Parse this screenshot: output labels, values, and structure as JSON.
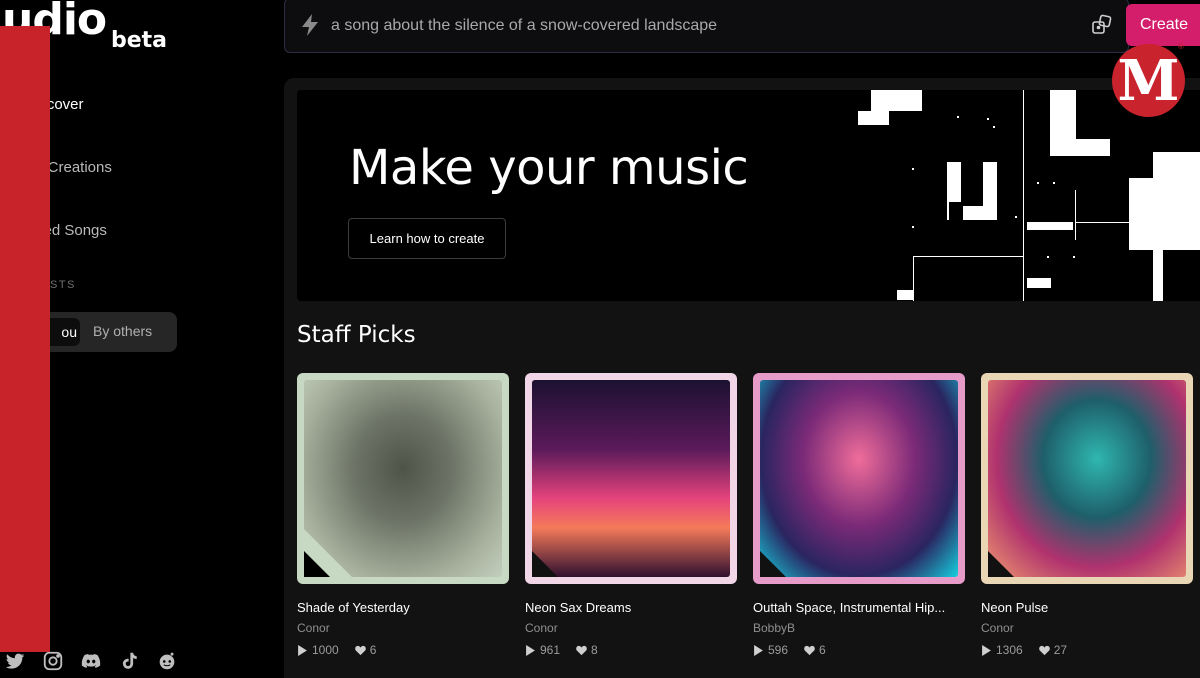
{
  "brand": {
    "logo_text": "udio",
    "beta_label": "beta"
  },
  "sidebar": {
    "nav": [
      {
        "label": "iscover"
      },
      {
        "label": "y Creations"
      },
      {
        "label": "ked Songs"
      }
    ],
    "section_label": "STS",
    "toggle": {
      "you": "ou",
      "others": "By others"
    },
    "socials": [
      "twitter-icon",
      "instagram-icon",
      "discord-icon",
      "tiktok-icon",
      "reddit-icon"
    ]
  },
  "prompt": {
    "text": "a song about the silence of a snow-covered landscape",
    "create_label": "Create"
  },
  "hero": {
    "title": "Make your music",
    "button_label": "Learn how to create"
  },
  "staff_picks": {
    "title": "Staff Picks",
    "cards": [
      {
        "title": "Shade of Yesterday",
        "artist": "Conor",
        "plays": "1000",
        "likes": "6",
        "frame": "#c7d8c3"
      },
      {
        "title": "Neon Sax Dreams",
        "artist": "Conor",
        "plays": "961",
        "likes": "8",
        "frame": "#f0d6e6"
      },
      {
        "title": "Outtah Space, Instrumental Hip...",
        "artist": "BobbyB",
        "plays": "596",
        "likes": "6",
        "frame": "#e79bc9"
      },
      {
        "title": "Neon Pulse",
        "artist": "Conor",
        "plays": "1306",
        "likes": "27",
        "frame": "#e9d6b5"
      }
    ]
  },
  "overlay": {
    "logo_letter": "M",
    "registered": "®"
  },
  "colors": {
    "accent": "#d41e6b",
    "red_overlay": "#c8232b"
  }
}
